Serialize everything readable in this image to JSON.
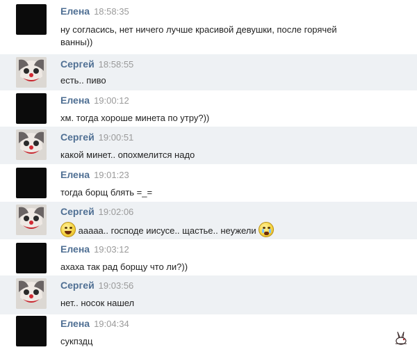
{
  "messages": [
    {
      "author": "Елена",
      "time": "18:58:35",
      "line1": "ну согласись, нет ничего лучше красивой девушки, после горячей",
      "line2": "ванны))"
    },
    {
      "author": "Сергей",
      "time": "18:58:55",
      "text": "есть.. пиво"
    },
    {
      "author": "Елена",
      "time": "19:00:12",
      "text": "хм. тогда хороше минета по утру?))"
    },
    {
      "author": "Сергей",
      "time": "19:00:51",
      "text": "какой минет.. опохмелится надо"
    },
    {
      "author": "Елена",
      "time": "19:01:23",
      "text": "тогда борщ блять =_="
    },
    {
      "author": "Сергей",
      "time": "19:02:06",
      "text": "ааааа.. господе иисусе.. щастье.. неужели",
      "emoji_before": "grin-emoji",
      "emoji_after": "crying-emoji"
    },
    {
      "author": "Елена",
      "time": "19:03:12",
      "text": "ахаха так рад борщу что ли?))"
    },
    {
      "author": "Сергей",
      "time": "19:03:56",
      "text": "нет.. носок нашел"
    },
    {
      "author": "Елена",
      "time": "19:04:34",
      "text": "сукпздц"
    }
  ],
  "colors": {
    "author": "#4f6f93",
    "time": "#9a9a9a",
    "text": "#222222",
    "alt_row": "#eef1f4"
  },
  "icons": {
    "elena_avatar": "black-avatar",
    "sergey_avatar": "clown-face-avatar",
    "watermark": "rabbit-watermark-icon"
  }
}
